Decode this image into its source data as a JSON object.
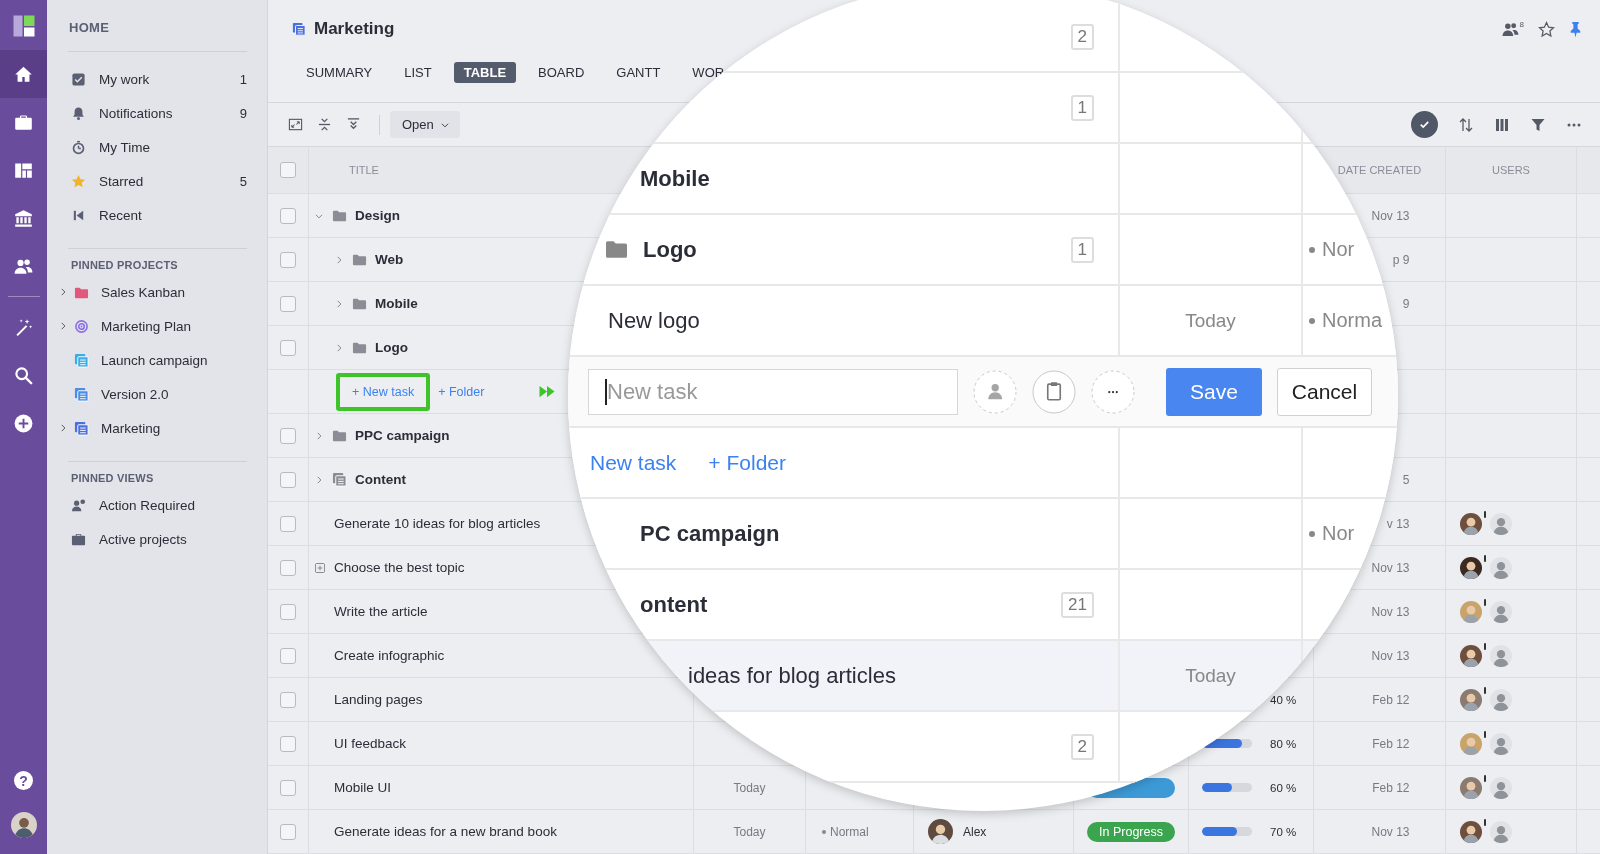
{
  "rail": {
    "items": [
      {
        "selected": true
      },
      {
        "selected": false
      },
      {
        "selected": false
      },
      {
        "selected": false
      },
      {
        "selected": false
      },
      {
        "selected": false
      },
      {
        "selected": false
      },
      {
        "selected": false
      }
    ],
    "help": "?"
  },
  "sidebar": {
    "home_title": "HOME",
    "nav": [
      {
        "label": "My work",
        "count": "1"
      },
      {
        "label": "Notifications",
        "count": "9"
      },
      {
        "label": "My Time"
      },
      {
        "label": "Starred",
        "count": "5"
      },
      {
        "label": "Recent"
      }
    ],
    "pinned_projects": {
      "title": "PINNED PROJECTS",
      "items": [
        {
          "label": "Sales Kanban",
          "expandable": true,
          "color": "#e2587c"
        },
        {
          "label": "Marketing Plan",
          "expandable": true,
          "color": "#8b6fe3"
        },
        {
          "label": "Launch campaign",
          "expandable": false,
          "color": "#39ade6"
        },
        {
          "label": "Version 2.0",
          "expandable": false,
          "color": "#4a8de6"
        },
        {
          "label": "Marketing",
          "expandable": true,
          "color": "#4c6fe0"
        }
      ]
    },
    "pinned_views": {
      "title": "PINNED VIEWS",
      "items": [
        {
          "label": "Action Required"
        },
        {
          "label": "Active projects"
        }
      ]
    }
  },
  "project": {
    "title": "Marketing",
    "followers": "8",
    "starred": false,
    "pinned": true,
    "tabs": [
      {
        "label": "SUMMARY",
        "selected": false
      },
      {
        "label": "LIST",
        "selected": false
      },
      {
        "label": "TABLE",
        "selected": true
      },
      {
        "label": "BOARD",
        "selected": false
      },
      {
        "label": "GANTT",
        "selected": false
      },
      {
        "label": "WOR",
        "selected": false
      }
    ]
  },
  "toolbar": {
    "dropdown": "Open",
    "check_filter_selected": true
  },
  "table": {
    "header": {
      "checked": false,
      "title": "TITLE",
      "date_created": "DATE CREATED",
      "users": "USERS"
    },
    "rows": [
      {
        "kind": "folder",
        "title": "Design",
        "expanded": true,
        "checked": false,
        "date_created": "Nov 13",
        "children": [
          {
            "kind": "folder",
            "title": "Web",
            "expanded": false,
            "checked": false,
            "date_created": "p 9"
          },
          {
            "kind": "folder",
            "title": "Mobile",
            "expanded": false,
            "checked": false,
            "date_created": "9"
          },
          {
            "kind": "folder",
            "title": "Logo",
            "expanded": false,
            "checked": false
          }
        ],
        "add_row": {
          "arrow": true,
          "links": [
            {
              "label": "+ New task",
              "highlighted": true
            },
            {
              "label": "+ Folder",
              "highlighted": false
            }
          ]
        }
      },
      {
        "kind": "folder",
        "title": "PPC campaign",
        "expanded": false,
        "checked": false
      },
      {
        "kind": "list",
        "title": "Content",
        "expanded": false,
        "checked": false,
        "date_created": "5"
      },
      {
        "kind": "task",
        "title": "Generate 10 ideas for blog articles",
        "checked": false,
        "has_subtasks": false,
        "date_created": "v 13",
        "users": [
          {
            "kind": "photo",
            "color": "#6e4e3c",
            "alert": true
          },
          {
            "kind": "placeholder",
            "alert": false
          }
        ]
      },
      {
        "kind": "task",
        "title": "Choose the best topic",
        "checked": false,
        "has_subtasks": true,
        "date_created": "Nov 13",
        "users": [
          {
            "kind": "photo",
            "color": "#3b2a22",
            "alert": true
          },
          {
            "kind": "placeholder",
            "alert": false
          }
        ]
      },
      {
        "kind": "task",
        "title": "Write the article",
        "checked": false,
        "has_subtasks": false,
        "date_created": "Nov 13",
        "users": [
          {
            "kind": "photo",
            "color": "#c9a46a",
            "alert": true
          },
          {
            "kind": "placeholder",
            "alert": false
          }
        ]
      },
      {
        "kind": "task",
        "title": "Create infographic",
        "checked": false,
        "has_subtasks": false,
        "date_created": "Nov 13",
        "users": [
          {
            "kind": "photo",
            "color": "#6e4e3c",
            "alert": true
          },
          {
            "kind": "placeholder",
            "alert": false
          }
        ]
      },
      {
        "kind": "task",
        "title": "Landing pages",
        "checked": false,
        "has_subtasks": false,
        "progress": {
          "text": "40 %"
        },
        "date_created": "Feb 12",
        "users": [
          {
            "kind": "photo",
            "color": "#8a7a70",
            "alert": true
          },
          {
            "kind": "placeholder",
            "alert": false
          }
        ]
      },
      {
        "kind": "task",
        "title": "UI feedback",
        "checked": false,
        "has_subtasks": false,
        "progress": {
          "level": 0.8,
          "text": "80 %"
        },
        "date_created": "Feb 12",
        "users": [
          {
            "kind": "photo",
            "color": "#c9a46a",
            "alert": true
          },
          {
            "kind": "placeholder",
            "alert": false
          }
        ]
      },
      {
        "kind": "task",
        "title": "Mobile UI",
        "checked": false,
        "has_subtasks": false,
        "due": "Today",
        "status": {
          "color": "#3d9ad6"
        },
        "progress": {
          "level": 0.6,
          "text": "60 %"
        },
        "date_created": "Feb 12",
        "users": [
          {
            "kind": "photo",
            "color": "#8a7a70",
            "alert": true
          },
          {
            "kind": "placeholder",
            "alert": false
          }
        ]
      },
      {
        "kind": "task",
        "title": "Generate ideas for a new brand book",
        "checked": false,
        "has_subtasks": false,
        "due": "Today",
        "priority": "Normal",
        "assignee": {
          "name": "Alex",
          "color": "#5e4a3e"
        },
        "status": {
          "label": "In Progress",
          "color": "#3ba44f"
        },
        "progress": {
          "level": 0.7,
          "text": "70 %"
        },
        "date_created": "Nov 13",
        "users": [
          {
            "kind": "photo",
            "color": "#6e4e3c",
            "alert": true
          },
          {
            "kind": "placeholder",
            "alert": false
          }
        ]
      }
    ]
  },
  "magnifier": {
    "rows": [
      {
        "kind": "count",
        "badge": "2"
      },
      {
        "kind": "count",
        "badge": "1"
      },
      {
        "kind": "heading",
        "title": "Mobile"
      },
      {
        "kind": "folder",
        "title": "Logo",
        "badge": "1",
        "priority": "Nor"
      },
      {
        "kind": "task",
        "title": "New logo",
        "due": "Today",
        "priority": "Norma",
        "highlighted": false
      },
      {
        "kind": "editor",
        "placeholder": "New task",
        "save": "Save",
        "cancel": "Cancel"
      },
      {
        "kind": "links",
        "links": [
          "New task",
          "+ Folder"
        ]
      },
      {
        "kind": "heading",
        "title": "PC campaign",
        "priority": "Nor"
      },
      {
        "kind": "heading",
        "title": "ontent",
        "badge": "21"
      },
      {
        "kind": "partial_task",
        "title": "ideas for blog articles",
        "due": "Today",
        "highlighted": true
      },
      {
        "kind": "count",
        "badge": "2"
      }
    ]
  }
}
